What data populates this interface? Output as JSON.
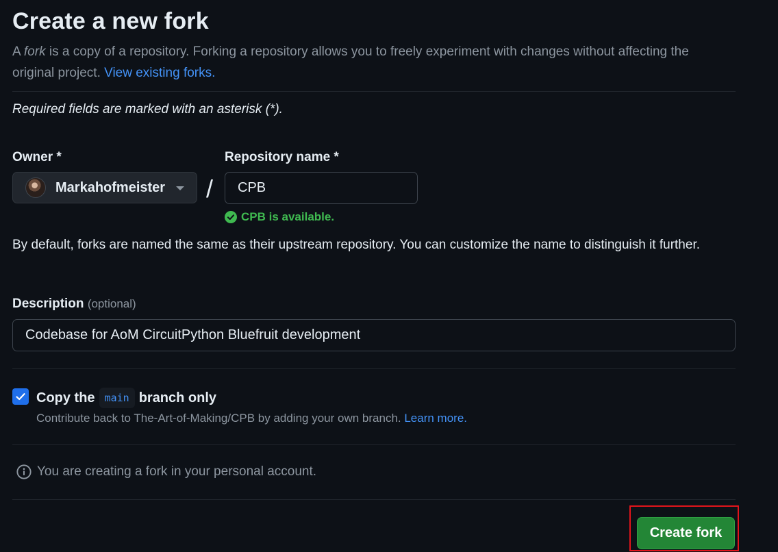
{
  "header": {
    "title": "Create a new fork",
    "intro_prefix": "A ",
    "intro_em": "fork",
    "intro_rest": " is a copy of a repository. Forking a repository allows you to freely experiment with changes without affecting the original project. ",
    "view_forks_link": "View existing forks."
  },
  "form": {
    "required_note": "Required fields are marked with an asterisk (*).",
    "owner_label": "Owner *",
    "owner_value": "Markahofmeister",
    "separator": "/",
    "repo_label": "Repository name *",
    "repo_value": "CPB",
    "availability": "CPB is available.",
    "default_note": "By default, forks are named the same as their upstream repository. You can customize the name to distinguish it further.",
    "description_label": "Description",
    "description_optional": "(optional)",
    "description_value": "Codebase for AoM CircuitPython Bluefruit development",
    "copy_prefix": "Copy the",
    "copy_branch": "main",
    "copy_suffix": "branch only",
    "copy_checked": true,
    "contribute_text": "Contribute back to The-Art-of-Making/CPB by adding your own branch. ",
    "learn_more": "Learn more.",
    "info_text": "You are creating a fork in your personal account.",
    "submit_label": "Create fork"
  },
  "colors": {
    "background": "#0d1117",
    "link": "#4493f8",
    "success": "#3fb950",
    "primary_button": "#238636",
    "checkbox": "#1f6feb",
    "highlight": "#e3141b"
  },
  "icons": {
    "owner_caret": "caret-down-icon",
    "availability": "check-circle-icon",
    "checkbox": "checkmark-icon",
    "info": "info-icon"
  }
}
